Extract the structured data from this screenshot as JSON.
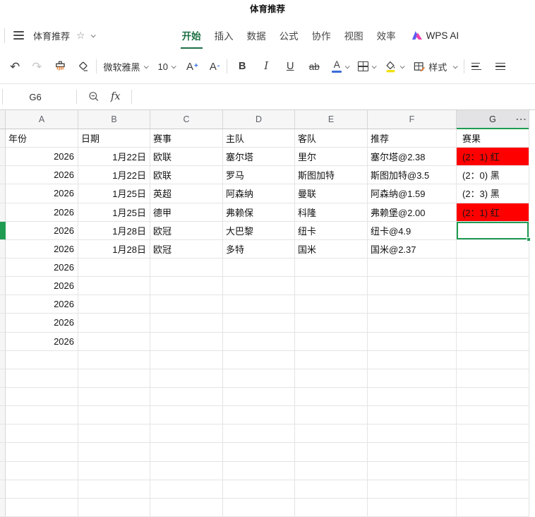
{
  "window": {
    "title": "体育推荐"
  },
  "menu_bar": {
    "doc_name": "体育推荐",
    "tabs": [
      {
        "id": "home",
        "label": "开始",
        "active": true
      },
      {
        "id": "insert",
        "label": "插入",
        "active": false
      },
      {
        "id": "data",
        "label": "数据",
        "active": false
      },
      {
        "id": "formula",
        "label": "公式",
        "active": false
      },
      {
        "id": "collaboration",
        "label": "协作",
        "active": false
      },
      {
        "id": "view",
        "label": "视图",
        "active": false
      },
      {
        "id": "efficiency",
        "label": "效率",
        "active": false
      }
    ],
    "wps_ai_label": "WPS AI"
  },
  "icons": {
    "star": "☆",
    "undo": "↶",
    "redo": "↷"
  },
  "toolbar": {
    "font_name": "微软雅黑",
    "font_size": "10",
    "grow_letter": "A",
    "grow_sign": "+",
    "shrink_letter": "A",
    "shrink_sign": "-",
    "bold": "B",
    "italic": "I",
    "underline": "U",
    "strikethrough": "ab",
    "font_color_letter": "A",
    "style_label": "样式"
  },
  "formula_bar": {
    "name_box": "G6",
    "fx_label": "fx"
  },
  "sheet": {
    "columns": [
      "A",
      "B",
      "C",
      "D",
      "E",
      "F",
      "G"
    ],
    "overflow_indicator": "···",
    "selected_cell": {
      "column": "G",
      "row": 6
    },
    "total_rows": 21,
    "rows": [
      {
        "cells": [
          "年份",
          "日期",
          "赛事",
          "主队",
          "客队",
          "推荐",
          "赛果"
        ]
      },
      {
        "cells": [
          "2026",
          "1月22日",
          "欧联",
          "塞尔塔",
          "里尔",
          "塞尔塔@2.38",
          "(2：1) 红"
        ],
        "result_red": true
      },
      {
        "cells": [
          "2026",
          "1月22日",
          "欧联",
          "罗马",
          "斯图加特",
          "斯图加特@3.5",
          "(2：0) 黑"
        ],
        "result_red": false
      },
      {
        "cells": [
          "2026",
          "1月25日",
          "英超",
          "阿森纳",
          "曼联",
          "阿森纳@1.59",
          "(2：3) 黑"
        ],
        "result_red": false
      },
      {
        "cells": [
          "2026",
          "1月25日",
          "德甲",
          "弗赖保",
          "科隆",
          "弗赖堡@2.00",
          "(2：1) 红"
        ],
        "result_red": true
      },
      {
        "cells": [
          "2026",
          "1月28日",
          "欧冠",
          "大巴黎",
          "纽卡",
          "纽卡@4.9",
          ""
        ],
        "result_red": false
      },
      {
        "cells": [
          "2026",
          "1月28日",
          "欧冠",
          "多特",
          "国米",
          "国米@2.37",
          ""
        ],
        "result_red": false
      },
      {
        "cells": [
          "2026",
          "",
          "",
          "",
          "",
          "",
          ""
        ]
      },
      {
        "cells": [
          "2026",
          "",
          "",
          "",
          "",
          "",
          ""
        ]
      },
      {
        "cells": [
          "2026",
          "",
          "",
          "",
          "",
          "",
          ""
        ]
      },
      {
        "cells": [
          "2026",
          "",
          "",
          "",
          "",
          "",
          ""
        ]
      },
      {
        "cells": [
          "2026",
          "",
          "",
          "",
          "",
          "",
          ""
        ]
      }
    ]
  },
  "colors": {
    "tab_green": "#1d7044",
    "selection_green": "#1f9c52",
    "result_red": "#ff0000",
    "font_color_bar": "#3a6bd8",
    "fill_color_bar": "#f2df12"
  }
}
